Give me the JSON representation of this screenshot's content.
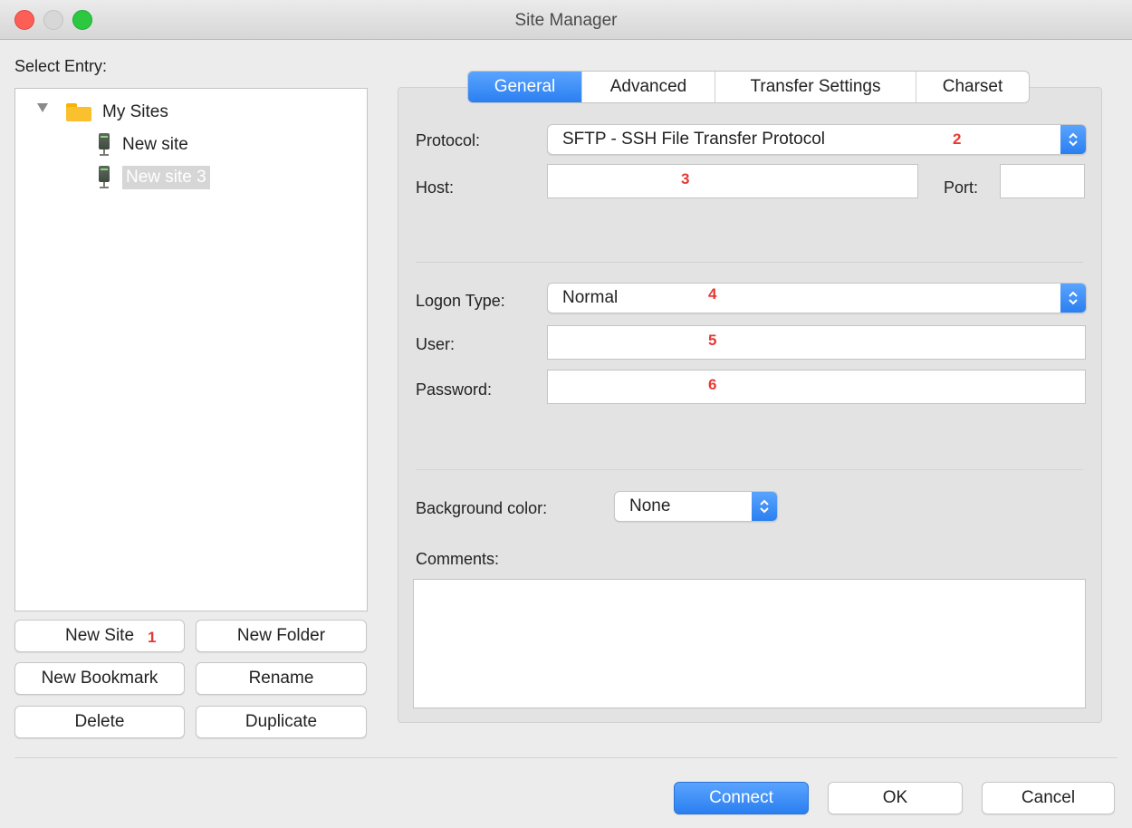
{
  "window": {
    "title": "Site Manager"
  },
  "left": {
    "select_entry_label": "Select Entry:",
    "tree": {
      "root": "My Sites",
      "children": [
        "New site",
        "New site 3"
      ]
    },
    "buttons": {
      "new_site": "New Site",
      "new_folder": "New Folder",
      "new_bookmark": "New Bookmark",
      "rename": "Rename",
      "delete": "Delete",
      "duplicate": "Duplicate"
    }
  },
  "tabs": [
    "General",
    "Advanced",
    "Transfer Settings",
    "Charset"
  ],
  "general": {
    "protocol_label": "Protocol:",
    "protocol_value": "SFTP - SSH File Transfer Protocol",
    "host_label": "Host:",
    "host_value": "",
    "port_label": "Port:",
    "port_value": "",
    "logon_type_label": "Logon Type:",
    "logon_type_value": "Normal",
    "user_label": "User:",
    "user_value": "",
    "password_label": "Password:",
    "password_value": "",
    "bg_color_label": "Background color:",
    "bg_color_value": "None",
    "comments_label": "Comments:",
    "comments_value": ""
  },
  "annotations": [
    "1",
    "2",
    "3",
    "4",
    "5",
    "6"
  ],
  "footer": {
    "connect": "Connect",
    "ok": "OK",
    "cancel": "Cancel"
  },
  "colors": {
    "accent": "#2a7ff0",
    "annotation": "#e53935"
  },
  "icons": [
    "folder-icon",
    "server-icon",
    "disclosure-triangle-icon",
    "stepper-icon"
  ]
}
